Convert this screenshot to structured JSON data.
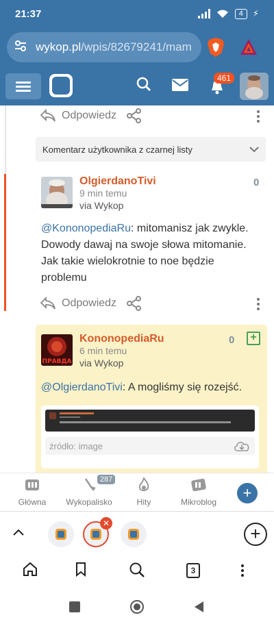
{
  "status_bar": {
    "time": "21:37",
    "battery": "4"
  },
  "browser": {
    "url_host": "wykop.pl",
    "url_path": "/wpis/82679241/mam"
  },
  "header": {
    "notifications_count": "461"
  },
  "thread": {
    "reply_label": "Odpowiedz",
    "blacklist_label": "Komentarz użytkownika z czarnej listy",
    "comments": [
      {
        "author": "OlgierdanoTivi",
        "time": "9 min temu",
        "via_prefix": "via",
        "via_app": "Wykop",
        "votes": "0",
        "mention": "@KononopediaRu",
        "text": ": mitomanisz jak zwykle. Dowody dawaj na swoje słowa mitomanie. Jak takie wielokrotnie to noe będzie problemu"
      },
      {
        "author": "KononopediaRu",
        "time": "6 min temu",
        "via_prefix": "via",
        "via_app": "Wykop",
        "votes": "0",
        "avatar_text": "ПРАВДА",
        "mention": "@OlgierdanoTivi",
        "text": ": A mogliśmy się rozejść.",
        "embed_source": "źródło: image"
      }
    ]
  },
  "site_nav": {
    "items": [
      {
        "label": "Główna"
      },
      {
        "label": "Wykopalisko",
        "badge": "287"
      },
      {
        "label": "Hity"
      },
      {
        "label": "Mikroblog"
      }
    ]
  },
  "browser_toolbar": {
    "tab_count": "3"
  },
  "colors": {
    "brand_blue": "#3a73a6",
    "accent_orange": "#f05223",
    "author_orange": "#d55b2a",
    "highlight_yellow": "#fbf2c8"
  }
}
